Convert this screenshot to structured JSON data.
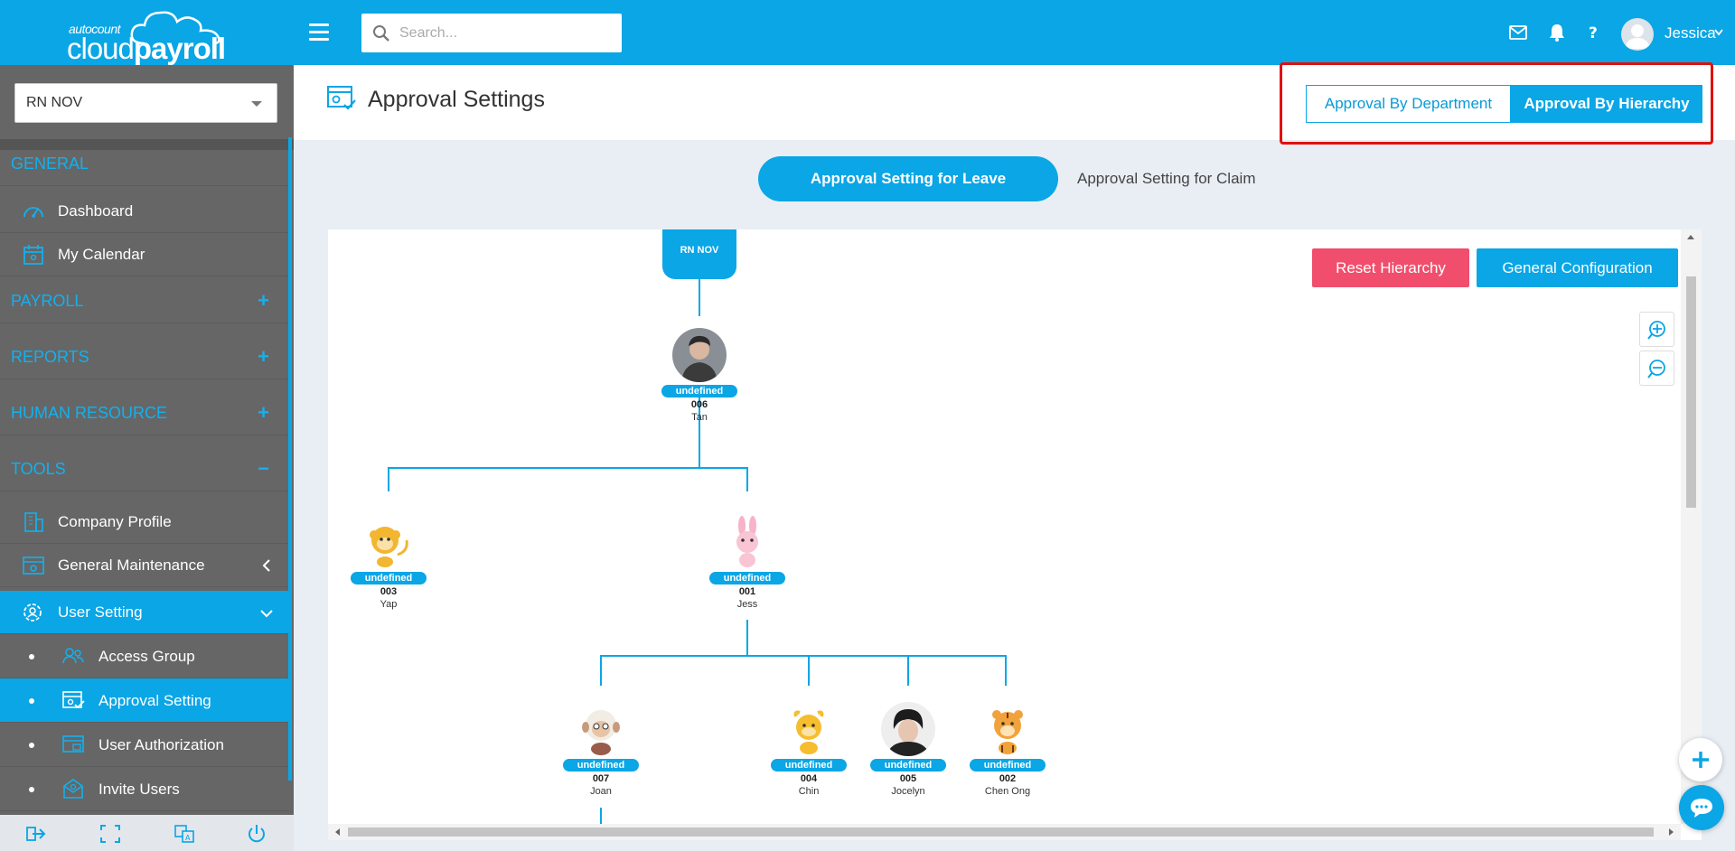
{
  "app": {
    "logo_small": "autocount",
    "logo_light": "cloud",
    "logo_bold": "payroll"
  },
  "topbar": {
    "search_placeholder": "Search...",
    "user_name": "Jessica"
  },
  "sidebar": {
    "company": "RN NOV",
    "sections": {
      "general": "GENERAL",
      "payroll": "PAYROLL",
      "reports": "REPORTS",
      "human_resource": "HUMAN RESOURCE",
      "tools": "TOOLS"
    },
    "toggles": {
      "payroll": "+",
      "reports": "+",
      "human_resource": "+",
      "tools": "−"
    },
    "items": {
      "dashboard": "Dashboard",
      "my_calendar": "My Calendar",
      "company_profile": "Company Profile",
      "general_maintenance": "General Maintenance",
      "user_setting": "User Setting"
    },
    "subitems": {
      "access_group": "Access Group",
      "approval_setting": "Approval Setting",
      "user_authorization": "User Authorization",
      "invite_users": "Invite Users"
    }
  },
  "header": {
    "title": "Approval Settings",
    "btn_department": "Approval By Department",
    "btn_hierarchy": "Approval By Hierarchy",
    "active_mode": "hierarchy"
  },
  "tabs": {
    "leave": "Approval Setting for Leave",
    "claim": "Approval Setting for Claim",
    "active": "leave"
  },
  "panel": {
    "btn_reset": "Reset Hierarchy",
    "btn_general": "General Configuration"
  },
  "hierarchy": {
    "root": "RN NOV",
    "nodes": [
      {
        "id": "n006",
        "badge": "undefined",
        "code": "006",
        "name": "Tan",
        "avatar": "photo-man-icon",
        "parent": "root"
      },
      {
        "id": "n003",
        "badge": "undefined",
        "code": "003",
        "name": "Yap",
        "avatar": "monkey-icon",
        "parent": "n006"
      },
      {
        "id": "n001",
        "badge": "undefined",
        "code": "001",
        "name": "Jess",
        "avatar": "rabbit-icon",
        "parent": "n006"
      },
      {
        "id": "n007",
        "badge": "undefined",
        "code": "007",
        "name": "Joan",
        "avatar": "sheep-icon",
        "parent": "n001"
      },
      {
        "id": "n004",
        "badge": "undefined",
        "code": "004",
        "name": "Chin",
        "avatar": "ox-icon",
        "parent": "n001"
      },
      {
        "id": "n005",
        "badge": "undefined",
        "code": "005",
        "name": "Jocelyn",
        "avatar": "photo-man-2-icon",
        "parent": "n001"
      },
      {
        "id": "n002",
        "badge": "undefined",
        "code": "002",
        "name": "Chen Ong",
        "avatar": "tiger-icon",
        "parent": "n001"
      }
    ]
  },
  "colors": {
    "primary": "#0aa6e6",
    "danger": "#f04e6c",
    "sidebar": "#666666",
    "highlight": "#e01010"
  }
}
